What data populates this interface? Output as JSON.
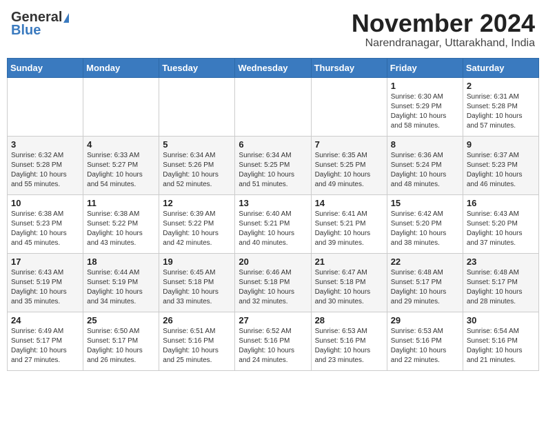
{
  "header": {
    "logo_line1": "General",
    "logo_line2": "Blue",
    "month_title": "November 2024",
    "location": "Narendranagar, Uttarakhand, India"
  },
  "days_of_week": [
    "Sunday",
    "Monday",
    "Tuesday",
    "Wednesday",
    "Thursday",
    "Friday",
    "Saturday"
  ],
  "weeks": [
    [
      {
        "day": "",
        "info": ""
      },
      {
        "day": "",
        "info": ""
      },
      {
        "day": "",
        "info": ""
      },
      {
        "day": "",
        "info": ""
      },
      {
        "day": "",
        "info": ""
      },
      {
        "day": "1",
        "info": "Sunrise: 6:30 AM\nSunset: 5:29 PM\nDaylight: 10 hours\nand 58 minutes."
      },
      {
        "day": "2",
        "info": "Sunrise: 6:31 AM\nSunset: 5:28 PM\nDaylight: 10 hours\nand 57 minutes."
      }
    ],
    [
      {
        "day": "3",
        "info": "Sunrise: 6:32 AM\nSunset: 5:28 PM\nDaylight: 10 hours\nand 55 minutes."
      },
      {
        "day": "4",
        "info": "Sunrise: 6:33 AM\nSunset: 5:27 PM\nDaylight: 10 hours\nand 54 minutes."
      },
      {
        "day": "5",
        "info": "Sunrise: 6:34 AM\nSunset: 5:26 PM\nDaylight: 10 hours\nand 52 minutes."
      },
      {
        "day": "6",
        "info": "Sunrise: 6:34 AM\nSunset: 5:25 PM\nDaylight: 10 hours\nand 51 minutes."
      },
      {
        "day": "7",
        "info": "Sunrise: 6:35 AM\nSunset: 5:25 PM\nDaylight: 10 hours\nand 49 minutes."
      },
      {
        "day": "8",
        "info": "Sunrise: 6:36 AM\nSunset: 5:24 PM\nDaylight: 10 hours\nand 48 minutes."
      },
      {
        "day": "9",
        "info": "Sunrise: 6:37 AM\nSunset: 5:23 PM\nDaylight: 10 hours\nand 46 minutes."
      }
    ],
    [
      {
        "day": "10",
        "info": "Sunrise: 6:38 AM\nSunset: 5:23 PM\nDaylight: 10 hours\nand 45 minutes."
      },
      {
        "day": "11",
        "info": "Sunrise: 6:38 AM\nSunset: 5:22 PM\nDaylight: 10 hours\nand 43 minutes."
      },
      {
        "day": "12",
        "info": "Sunrise: 6:39 AM\nSunset: 5:22 PM\nDaylight: 10 hours\nand 42 minutes."
      },
      {
        "day": "13",
        "info": "Sunrise: 6:40 AM\nSunset: 5:21 PM\nDaylight: 10 hours\nand 40 minutes."
      },
      {
        "day": "14",
        "info": "Sunrise: 6:41 AM\nSunset: 5:21 PM\nDaylight: 10 hours\nand 39 minutes."
      },
      {
        "day": "15",
        "info": "Sunrise: 6:42 AM\nSunset: 5:20 PM\nDaylight: 10 hours\nand 38 minutes."
      },
      {
        "day": "16",
        "info": "Sunrise: 6:43 AM\nSunset: 5:20 PM\nDaylight: 10 hours\nand 37 minutes."
      }
    ],
    [
      {
        "day": "17",
        "info": "Sunrise: 6:43 AM\nSunset: 5:19 PM\nDaylight: 10 hours\nand 35 minutes."
      },
      {
        "day": "18",
        "info": "Sunrise: 6:44 AM\nSunset: 5:19 PM\nDaylight: 10 hours\nand 34 minutes."
      },
      {
        "day": "19",
        "info": "Sunrise: 6:45 AM\nSunset: 5:18 PM\nDaylight: 10 hours\nand 33 minutes."
      },
      {
        "day": "20",
        "info": "Sunrise: 6:46 AM\nSunset: 5:18 PM\nDaylight: 10 hours\nand 32 minutes."
      },
      {
        "day": "21",
        "info": "Sunrise: 6:47 AM\nSunset: 5:18 PM\nDaylight: 10 hours\nand 30 minutes."
      },
      {
        "day": "22",
        "info": "Sunrise: 6:48 AM\nSunset: 5:17 PM\nDaylight: 10 hours\nand 29 minutes."
      },
      {
        "day": "23",
        "info": "Sunrise: 6:48 AM\nSunset: 5:17 PM\nDaylight: 10 hours\nand 28 minutes."
      }
    ],
    [
      {
        "day": "24",
        "info": "Sunrise: 6:49 AM\nSunset: 5:17 PM\nDaylight: 10 hours\nand 27 minutes."
      },
      {
        "day": "25",
        "info": "Sunrise: 6:50 AM\nSunset: 5:17 PM\nDaylight: 10 hours\nand 26 minutes."
      },
      {
        "day": "26",
        "info": "Sunrise: 6:51 AM\nSunset: 5:16 PM\nDaylight: 10 hours\nand 25 minutes."
      },
      {
        "day": "27",
        "info": "Sunrise: 6:52 AM\nSunset: 5:16 PM\nDaylight: 10 hours\nand 24 minutes."
      },
      {
        "day": "28",
        "info": "Sunrise: 6:53 AM\nSunset: 5:16 PM\nDaylight: 10 hours\nand 23 minutes."
      },
      {
        "day": "29",
        "info": "Sunrise: 6:53 AM\nSunset: 5:16 PM\nDaylight: 10 hours\nand 22 minutes."
      },
      {
        "day": "30",
        "info": "Sunrise: 6:54 AM\nSunset: 5:16 PM\nDaylight: 10 hours\nand 21 minutes."
      }
    ]
  ]
}
